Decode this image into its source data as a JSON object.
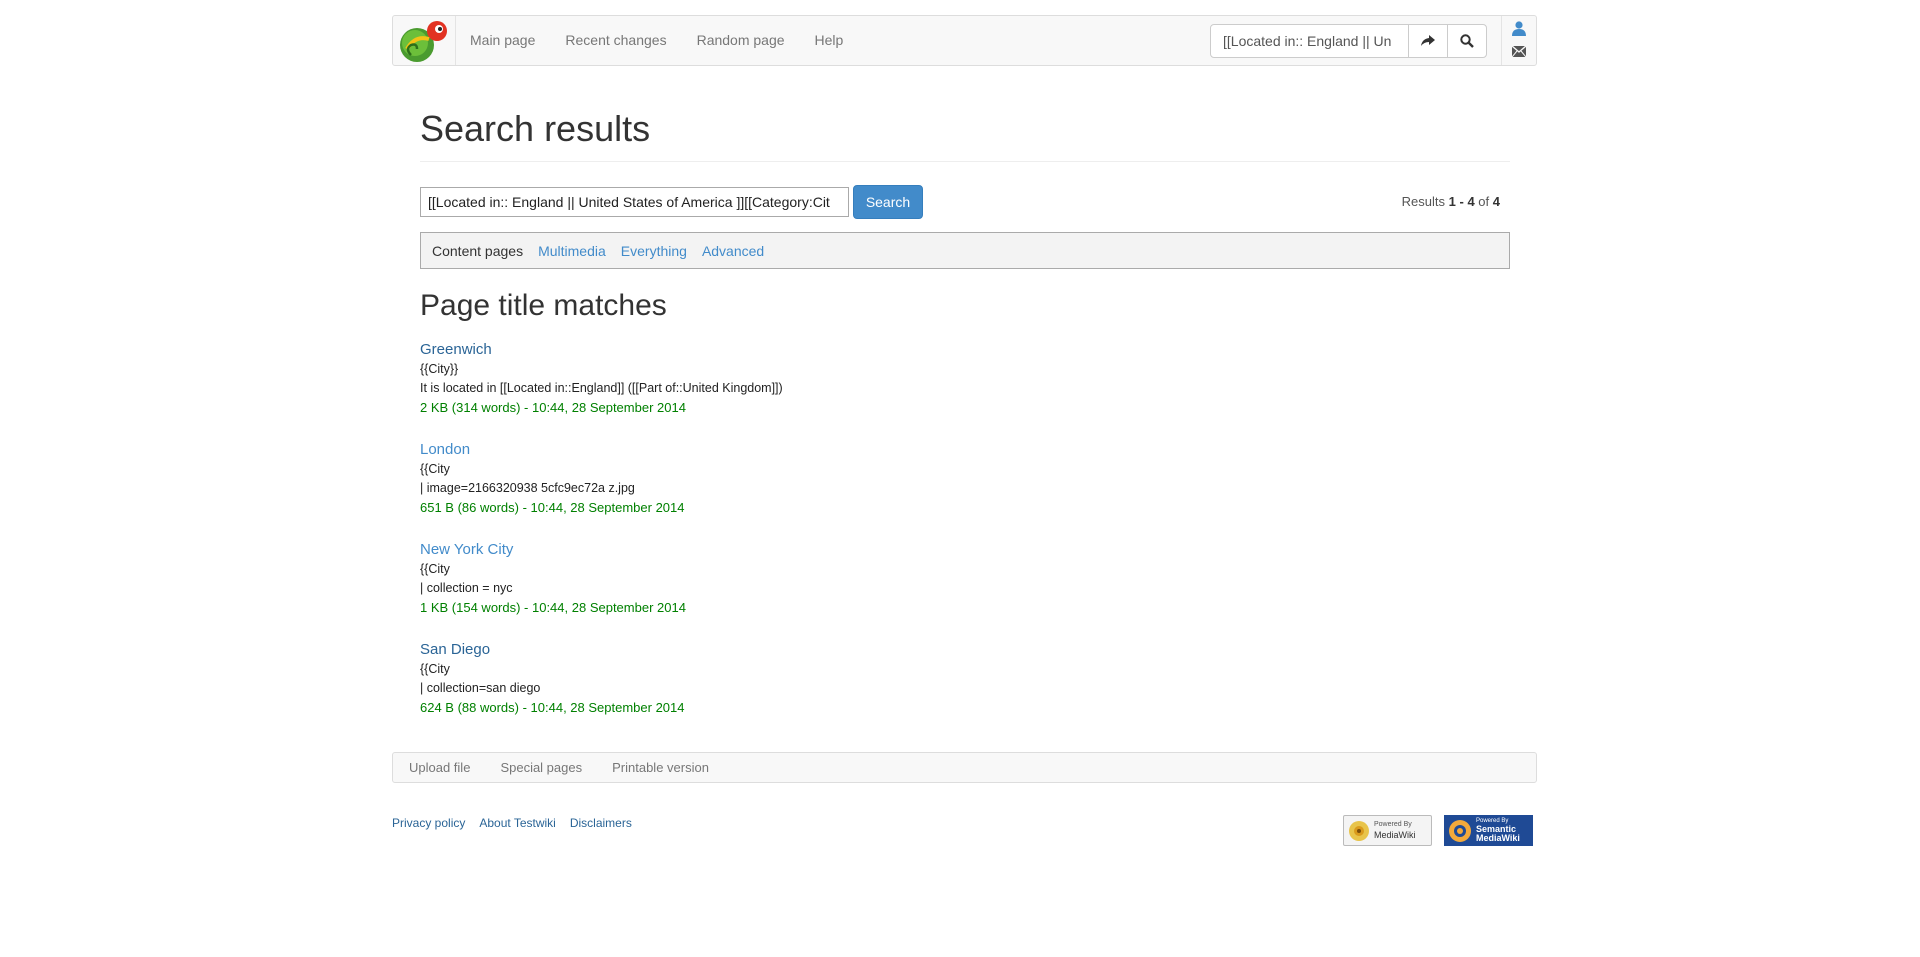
{
  "nav": {
    "links": [
      "Main page",
      "Recent changes",
      "Random page",
      "Help"
    ],
    "search_value": "[[Located in:: England || Un"
  },
  "page": {
    "title": "Search results",
    "search_value": "[[Located in:: England || United States of America ]][[Category:Cit",
    "search_button": "Search",
    "results_label": "Results",
    "range_start": "1",
    "range_sep": " - ",
    "range_end": "4",
    "of": "of",
    "total": "4"
  },
  "profiles": {
    "current": "Content pages",
    "links": [
      "Multimedia",
      "Everything",
      "Advanced"
    ]
  },
  "section_title": "Page title matches",
  "results": [
    {
      "title": "Greenwich",
      "snippets": [
        "{{City}}",
        "It is located in [[Located in::England]] ([[Part of::United Kingdom]])"
      ],
      "meta": "2 KB (314 words) - 10:44, 28 September 2014"
    },
    {
      "title": "London",
      "snippets": [
        "{{City",
        "| image=2166320938 5cfc9ec72a z.jpg"
      ],
      "meta": "651 B (86 words) - 10:44, 28 September 2014"
    },
    {
      "title": "New York City",
      "snippets": [
        "{{City",
        "| collection = nyc"
      ],
      "meta": "1 KB (154 words) - 10:44, 28 September 2014"
    },
    {
      "title": "San Diego",
      "snippets": [
        "{{City",
        "| collection=san diego"
      ],
      "meta": "624 B (88 words) - 10:44, 28 September 2014"
    }
  ],
  "footer_tools": [
    "Upload file",
    "Special pages",
    "Printable version"
  ],
  "footer_links": [
    "Privacy policy",
    "About Testwiki",
    "Disclaimers"
  ],
  "badges": {
    "mediawiki": [
      "Powered By",
      "MediaWiki"
    ],
    "smw": [
      "Powered By",
      "Semantic",
      "MediaWiki"
    ]
  },
  "colors": {
    "link": "#2a6496",
    "accent": "#428bca",
    "meta_green": "#008000"
  }
}
